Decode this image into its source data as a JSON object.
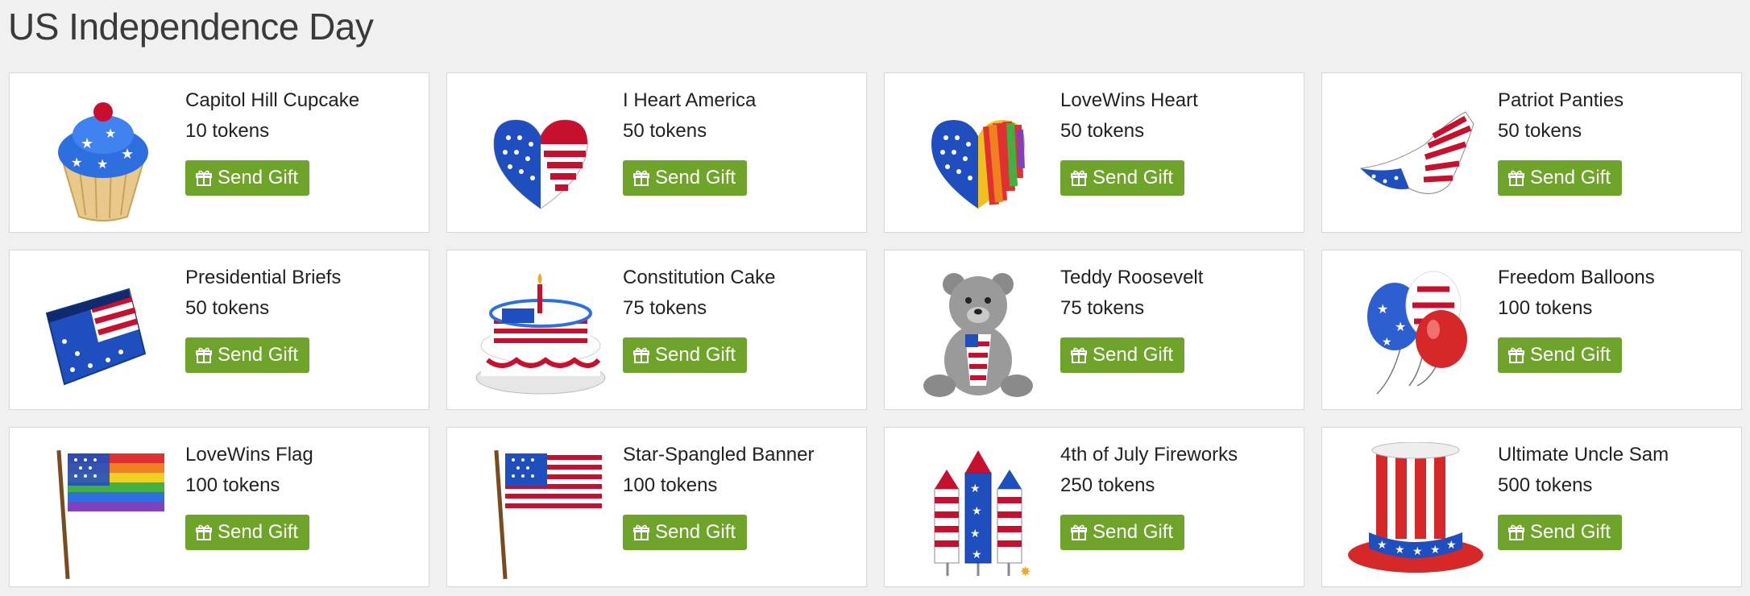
{
  "page": {
    "title": "US Independence Day"
  },
  "button_icon": "gift-icon",
  "button_color": "#6ea42a",
  "gifts": [
    {
      "name": "Capitol Hill Cupcake",
      "price": "10 tokens",
      "button": "Send Gift",
      "icon": "cupcake-icon"
    },
    {
      "name": "I Heart America",
      "price": "50 tokens",
      "button": "Send Gift",
      "icon": "flag-heart-icon"
    },
    {
      "name": "LoveWins Heart",
      "price": "50 tokens",
      "button": "Send Gift",
      "icon": "rainbow-heart-icon"
    },
    {
      "name": "Patriot Panties",
      "price": "50 tokens",
      "button": "Send Gift",
      "icon": "panties-icon"
    },
    {
      "name": "Presidential Briefs",
      "price": "50 tokens",
      "button": "Send Gift",
      "icon": "briefs-icon"
    },
    {
      "name": "Constitution Cake",
      "price": "75 tokens",
      "button": "Send Gift",
      "icon": "cake-icon"
    },
    {
      "name": "Teddy Roosevelt",
      "price": "75 tokens",
      "button": "Send Gift",
      "icon": "teddy-bear-icon"
    },
    {
      "name": "Freedom Balloons",
      "price": "100 tokens",
      "button": "Send Gift",
      "icon": "balloons-icon"
    },
    {
      "name": "LoveWins Flag",
      "price": "100 tokens",
      "button": "Send Gift",
      "icon": "rainbow-flag-icon"
    },
    {
      "name": "Star-Spangled Banner",
      "price": "100 tokens",
      "button": "Send Gift",
      "icon": "us-flag-icon"
    },
    {
      "name": "4th of July Fireworks",
      "price": "250 tokens",
      "button": "Send Gift",
      "icon": "fireworks-icon"
    },
    {
      "name": "Ultimate Uncle Sam",
      "price": "500 tokens",
      "button": "Send Gift",
      "icon": "uncle-sam-hat-icon"
    }
  ]
}
